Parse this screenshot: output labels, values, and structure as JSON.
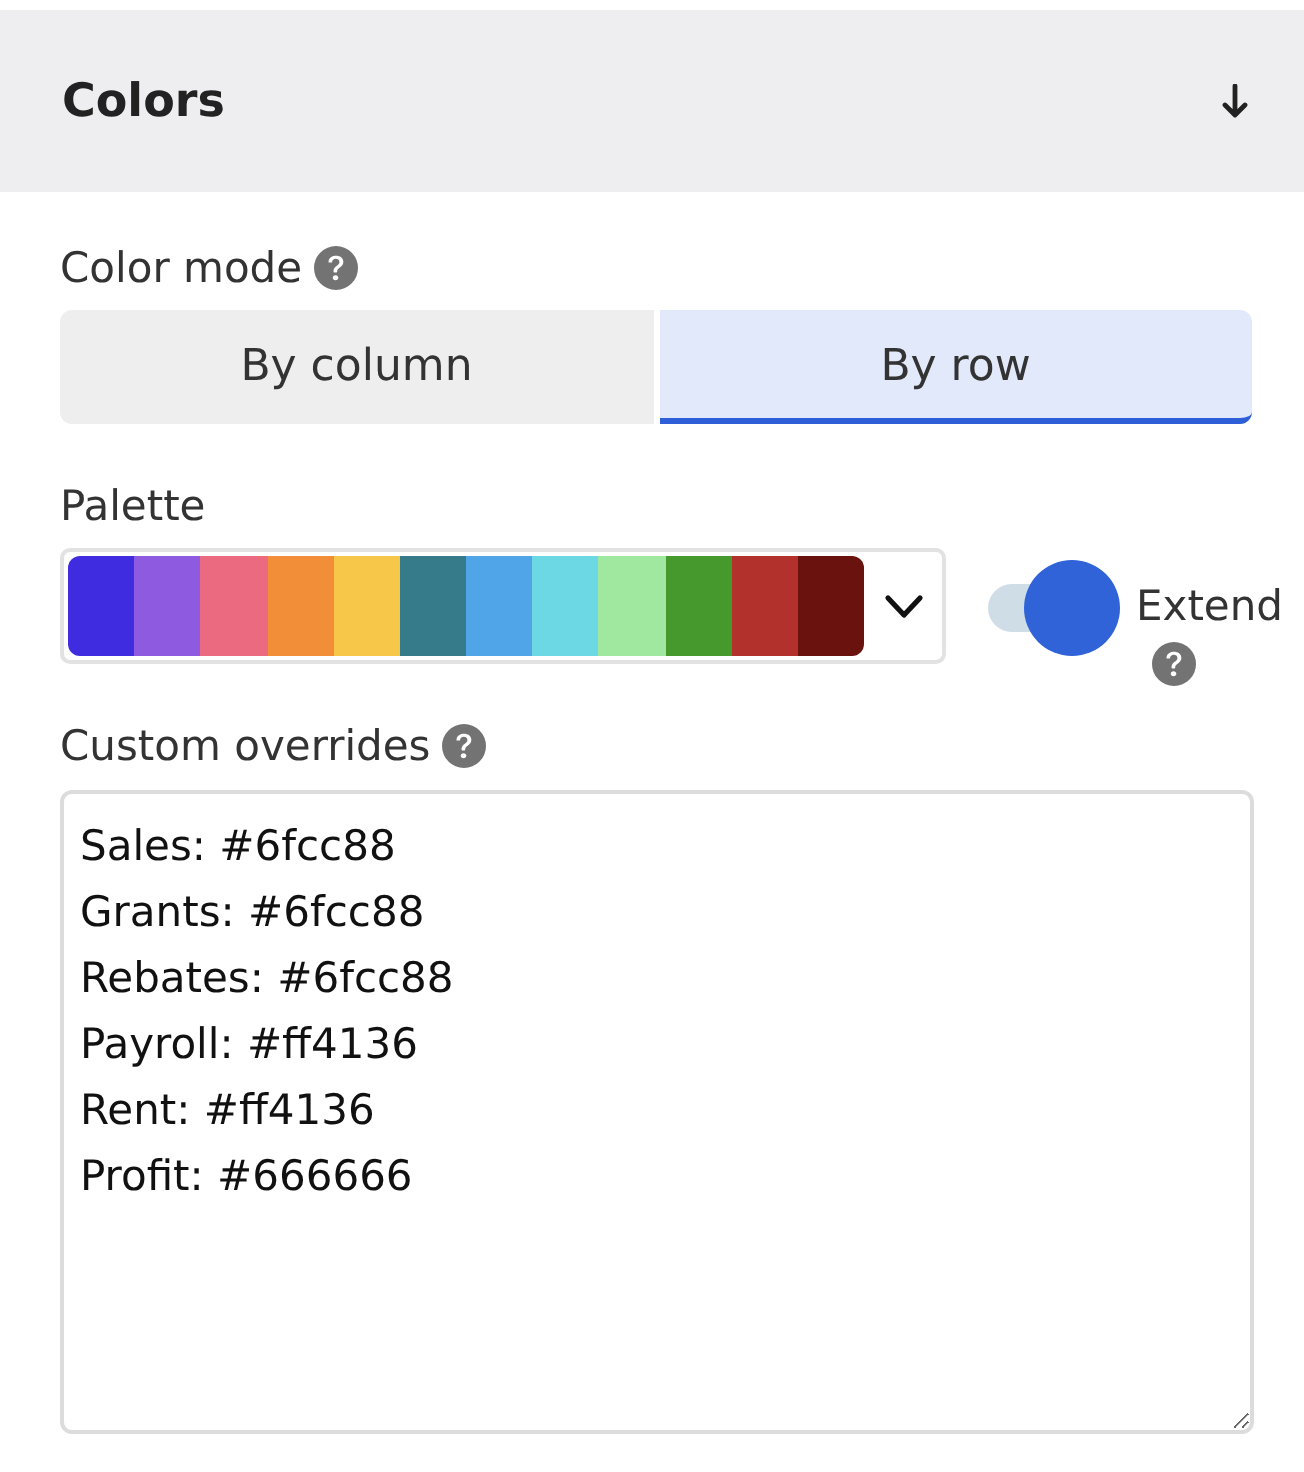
{
  "section": {
    "title": "Colors"
  },
  "color_mode": {
    "label": "Color mode",
    "help": true,
    "options": [
      {
        "label": "By column",
        "selected": false
      },
      {
        "label": "By row",
        "selected": true
      }
    ]
  },
  "palette": {
    "label": "Palette",
    "swatches": [
      {
        "color": "#3f2be0"
      },
      {
        "color": "#8e5ae0"
      },
      {
        "color": "#ec6a80"
      },
      {
        "color": "#f18e37"
      },
      {
        "color": "#f6c748"
      },
      {
        "color": "#357b8a"
      },
      {
        "color": "#50a4e8"
      },
      {
        "color": "#6bd8e3"
      },
      {
        "color": "#a0e8a0"
      },
      {
        "color": "#46992d"
      },
      {
        "color": "#b3312c"
      },
      {
        "color": "#6a120e"
      }
    ],
    "extend": {
      "label": "Extend",
      "help": true,
      "on": true
    }
  },
  "custom_overrides": {
    "label": "Custom overrides",
    "help": true,
    "value": "Sales: #6fcc88\nGrants: #6fcc88\nRebates: #6fcc88\nPayroll: #ff4136\nRent: #ff4136\nProfit: #666666"
  }
}
